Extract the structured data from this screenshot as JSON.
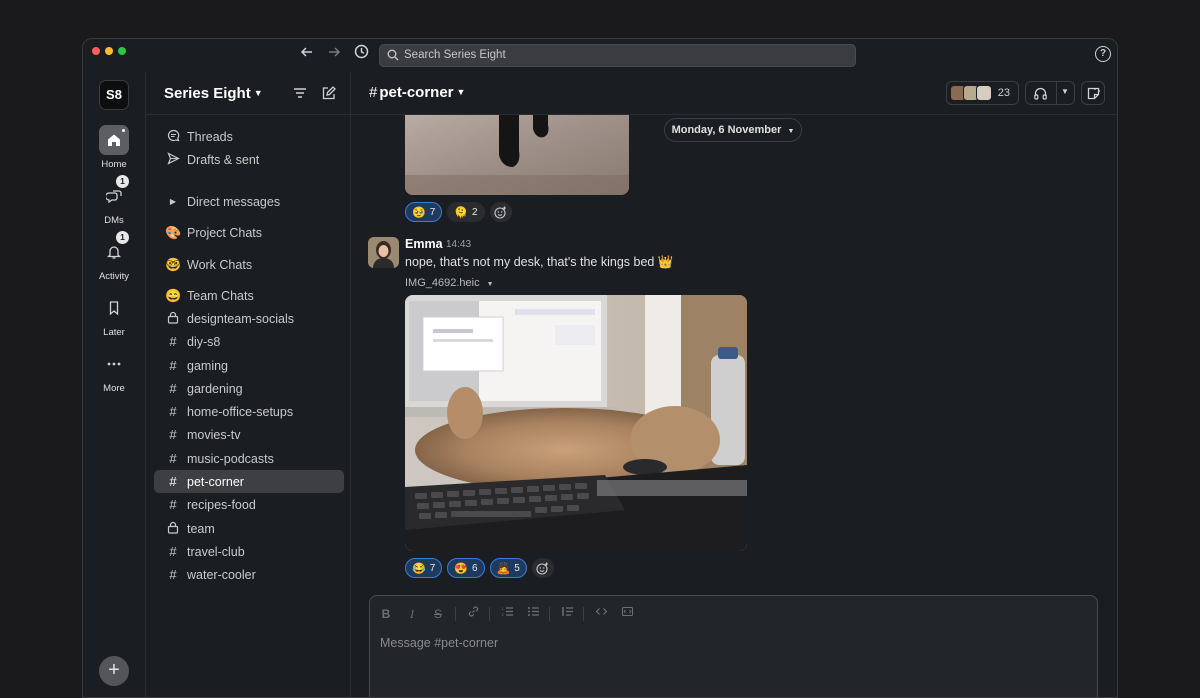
{
  "window": {
    "search_placeholder": "Search Series Eight"
  },
  "rail": {
    "workspace_initials": "S8",
    "items": [
      {
        "label": "Home",
        "icon": "home-icon",
        "badge": ""
      },
      {
        "label": "DMs",
        "icon": "dms-icon",
        "badge": "1"
      },
      {
        "label": "Activity",
        "icon": "bell-icon",
        "badge": "1"
      },
      {
        "label": "Later",
        "icon": "bookmark-icon",
        "badge": ""
      },
      {
        "label": "More",
        "icon": "more-icon",
        "badge": ""
      }
    ]
  },
  "sidebar": {
    "workspace_name": "Series Eight",
    "items": [
      {
        "label": "Threads",
        "icon": "threads-icon"
      },
      {
        "label": "Drafts & sent",
        "icon": "send-icon"
      },
      {
        "label": "Direct messages",
        "icon": "caret-right-icon"
      },
      {
        "label": "Project Chats",
        "icon": "palette-emoji"
      },
      {
        "label": "Work Chats",
        "icon": "nerd-emoji"
      },
      {
        "label": "Team Chats",
        "icon": "grin-emoji"
      },
      {
        "label": "designteam-socials",
        "icon": "lock-icon"
      },
      {
        "label": "diy-s8",
        "icon": "hash-icon"
      },
      {
        "label": "gaming",
        "icon": "hash-icon"
      },
      {
        "label": "gardening",
        "icon": "hash-icon"
      },
      {
        "label": "home-office-setups",
        "icon": "hash-icon"
      },
      {
        "label": "movies-tv",
        "icon": "hash-icon"
      },
      {
        "label": "music-podcasts",
        "icon": "hash-icon"
      },
      {
        "label": "pet-corner",
        "icon": "hash-icon"
      },
      {
        "label": "recipes-food",
        "icon": "hash-icon"
      },
      {
        "label": "team",
        "icon": "lock-icon"
      },
      {
        "label": "travel-club",
        "icon": "hash-icon"
      },
      {
        "label": "water-cooler",
        "icon": "hash-icon"
      }
    ],
    "active_item": "pet-corner"
  },
  "channel": {
    "hash": "#",
    "name": "pet-corner",
    "member_count": "23",
    "date_divider": "Monday, 6 November"
  },
  "messages": {
    "first_reactions": [
      {
        "emoji": "🥹",
        "count": "7",
        "mine": true
      },
      {
        "emoji": "🫠",
        "count": "2",
        "mine": false
      }
    ],
    "emma": {
      "author": "Emma",
      "time": "14:43",
      "text": "nope, that's not my desk, that's the kings bed 👑",
      "file_name": "IMG_4692.heic",
      "reactions": [
        {
          "emoji": "😂",
          "count": "7",
          "mine": true
        },
        {
          "emoji": "😍",
          "count": "6",
          "mine": true
        },
        {
          "emoji": "🙇",
          "count": "5",
          "mine": true
        }
      ]
    }
  },
  "composer": {
    "placeholder": "Message #pet-corner",
    "toolbar": [
      "B",
      "I",
      "S",
      "link",
      "ordered-list",
      "bullet-list",
      "quote",
      "code",
      "code-block"
    ]
  },
  "colors": {
    "background": "#1a1d21",
    "accent_blue": "#3a7bd5",
    "active_item": "#3e3f43"
  }
}
